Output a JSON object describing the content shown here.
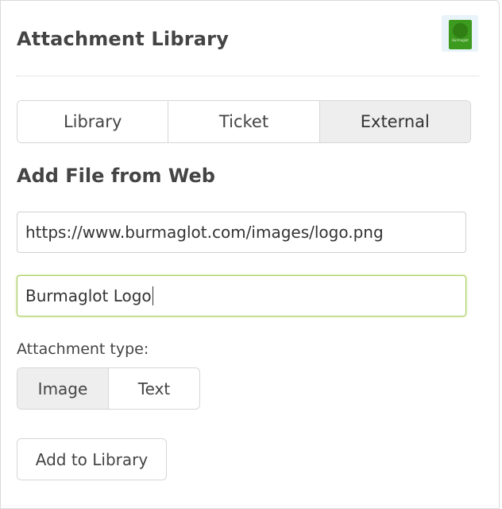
{
  "header": {
    "title": "Attachment Library",
    "thumbnail_caption": "Burmaglot"
  },
  "tabs": [
    {
      "label": "Library",
      "active": false
    },
    {
      "label": "Ticket",
      "active": false
    },
    {
      "label": "External",
      "active": true
    }
  ],
  "section": {
    "title": "Add File from Web"
  },
  "form": {
    "url_value": "https://www.burmaglot.com/images/logo.png",
    "name_value": "Burmaglot Logo",
    "attachment_type_label": "Attachment type:",
    "types": [
      {
        "label": "Image",
        "active": true
      },
      {
        "label": "Text",
        "active": false
      }
    ],
    "submit_label": "Add to Library"
  },
  "colors": {
    "focus_border": "#a7cc5a",
    "active_segment": "#eeeeee",
    "thumbnail_green": "#3c9a1e"
  }
}
